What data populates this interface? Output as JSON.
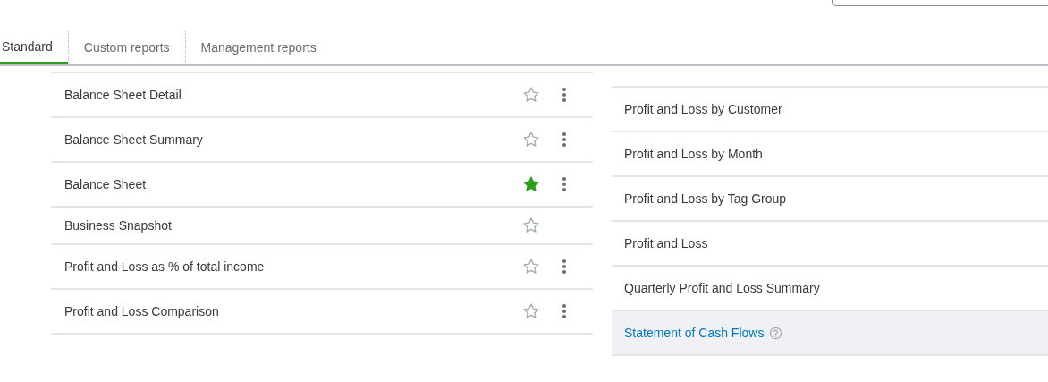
{
  "tabs": [
    {
      "label": "Standard",
      "selected": true
    },
    {
      "label": "Custom reports",
      "selected": false
    },
    {
      "label": "Management reports",
      "selected": false
    }
  ],
  "left_reports": [
    {
      "name": "Balance Sheet Detail",
      "favorite": false,
      "has_menu": true
    },
    {
      "name": "Balance Sheet Summary",
      "favorite": false,
      "has_menu": true
    },
    {
      "name": "Balance Sheet",
      "favorite": true,
      "has_menu": true
    },
    {
      "name": "Business Snapshot",
      "favorite": false,
      "has_menu": false
    },
    {
      "name": "Profit and Loss as % of total income",
      "favorite": false,
      "has_menu": true
    },
    {
      "name": "Profit and Loss Comparison",
      "favorite": false,
      "has_menu": true
    }
  ],
  "right_reports": [
    {
      "name": "Profit and Loss by Customer",
      "selected": false
    },
    {
      "name": "Profit and Loss by Month",
      "selected": false
    },
    {
      "name": "Profit and Loss by Tag Group",
      "selected": false
    },
    {
      "name": "Profit and Loss",
      "selected": false
    },
    {
      "name": "Quarterly Profit and Loss Summary",
      "selected": false
    },
    {
      "name": "Statement of Cash Flows",
      "selected": true
    }
  ]
}
